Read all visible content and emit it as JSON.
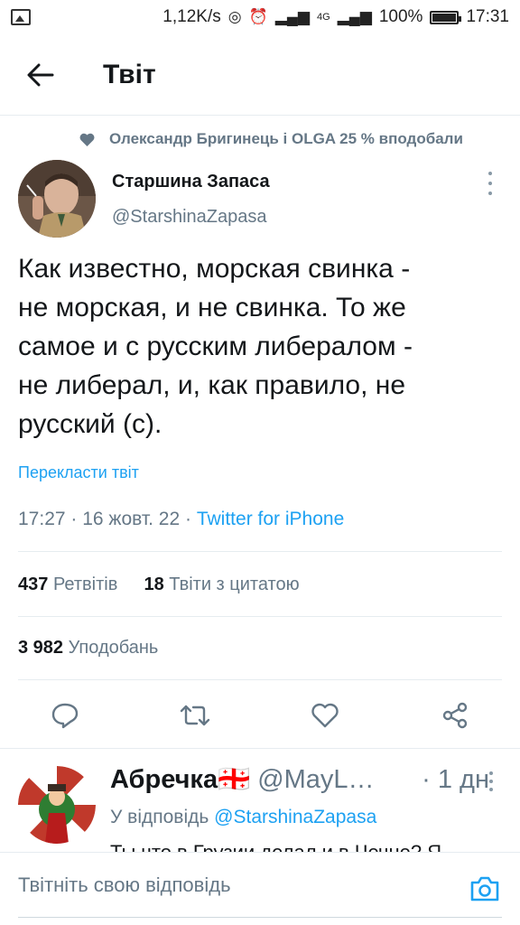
{
  "status_bar": {
    "speed": "1,12K/s",
    "network": "4G",
    "battery": "100%",
    "time": "17:31"
  },
  "header": {
    "title": "Твіт"
  },
  "social_context": "Олександр Бригинець і OLGA 25 % вподобали",
  "tweet": {
    "author_name": "Старшина Запаса",
    "author_handle": "@StarshinaZapasa",
    "text_lines": [
      "Как известно, морская свинка -",
      "не морская, и не свинка. То же",
      "самое и с русским либералом -",
      "не либерал, и, как правило, не",
      "русский (с)."
    ],
    "translate_label": "Перекласти твіт",
    "time": "17:27",
    "date": "16 жовт. 22",
    "source": "Twitter for iPhone"
  },
  "stats": {
    "retweets_count": "437",
    "retweets_label": "Ретвітів",
    "quotes_count": "18",
    "quotes_label": "Твіти з цитатою",
    "likes_count": "3 982",
    "likes_label": "Уподобань"
  },
  "actions": [
    "reply-icon",
    "retweet-icon",
    "like-icon",
    "share-icon"
  ],
  "reply": {
    "name": "Абречка🇬🇪",
    "handle": "@MayL…",
    "time": "· 1 дн",
    "reply_to_label": "У відповідь",
    "reply_to_mention": "@StarshinaZapasa",
    "snippet": "Ты что в Грузии делал и в Чечне? Я"
  },
  "composer": {
    "placeholder": "Твітніть свою відповідь"
  },
  "colors": {
    "accent": "#1da1f2",
    "secondary_text": "#657786",
    "primary_text": "#14171a"
  }
}
